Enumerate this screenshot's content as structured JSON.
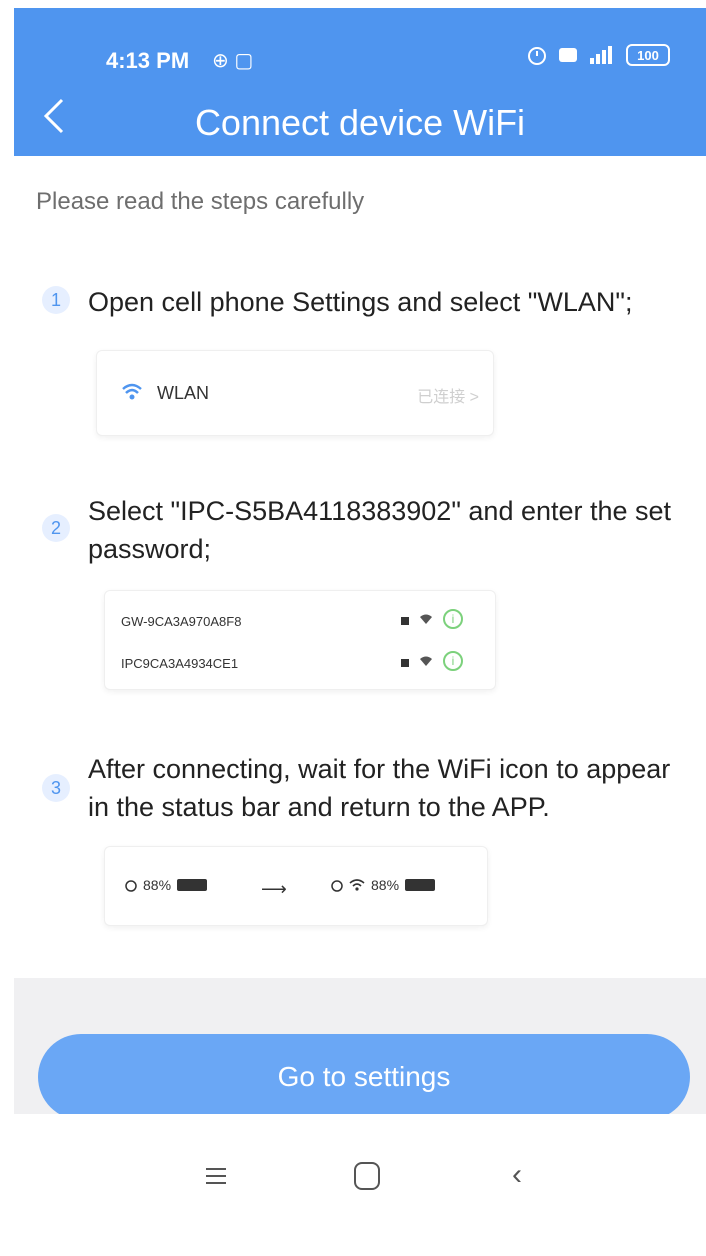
{
  "status_bar": {
    "time": "4:13 PM",
    "left_icons": "⊕ ▢",
    "battery": "100"
  },
  "header": {
    "title": "Connect device WiFi",
    "back_icon": "chevron-left"
  },
  "intro": "Please read the steps carefully",
  "steps": [
    {
      "number": "1",
      "text": "Open cell phone Settings and select \"WLAN\";"
    },
    {
      "number": "2",
      "text": "Select \"IPC-S5BA4118383902\" and enter the set password;"
    },
    {
      "number": "3",
      "text": "After connecting, wait for the WiFi icon to appear in the status bar and return to the APP."
    }
  ],
  "wlan_card": {
    "label": "WLAN",
    "status": "已连接 >"
  },
  "networks": [
    {
      "name": "GW-9CA3A970A8F8"
    },
    {
      "name": "IPC9CA3A4934CE1"
    }
  ],
  "status_preview": {
    "before": "88%",
    "after": "88%"
  },
  "button": {
    "label": "Go to settings"
  },
  "navbar": {
    "menu": "menu",
    "home": "home",
    "back": "back"
  },
  "colors": {
    "primary": "#4f95ef",
    "button": "#6aa7f5"
  }
}
